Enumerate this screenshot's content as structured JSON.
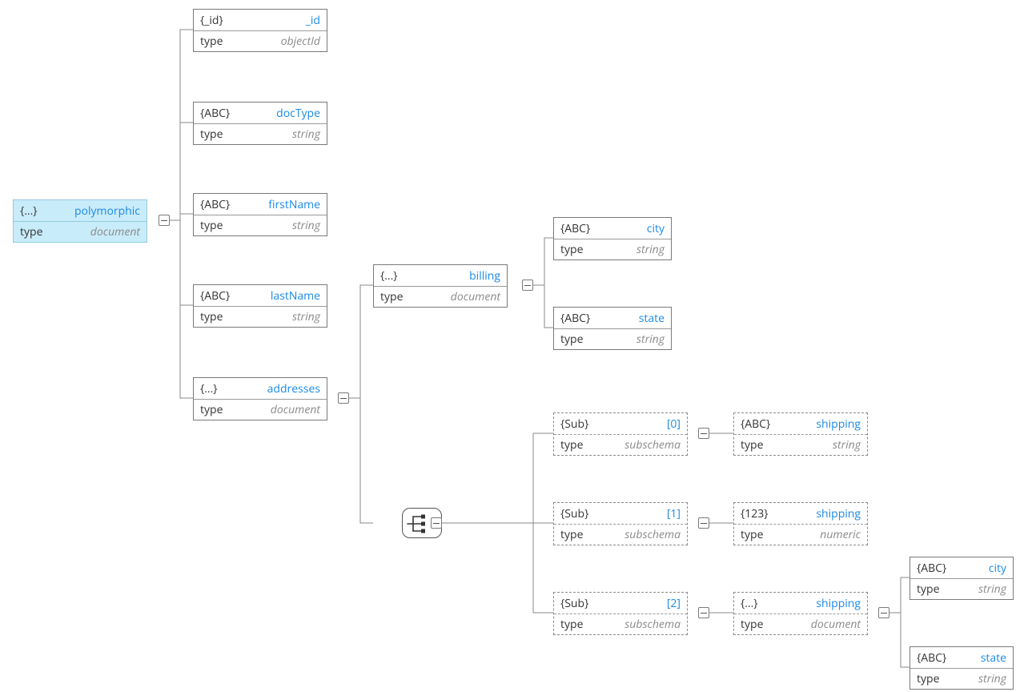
{
  "type_label": "type",
  "nodes": {
    "root": {
      "tag": "{...}",
      "name": "polymorphic",
      "type": "document"
    },
    "id": {
      "tag": "{_id}",
      "name": "_id",
      "type": "objectId"
    },
    "docType": {
      "tag": "{ABC}",
      "name": "docType",
      "type": "string"
    },
    "firstName": {
      "tag": "{ABC}",
      "name": "firstName",
      "type": "string"
    },
    "lastName": {
      "tag": "{ABC}",
      "name": "lastName",
      "type": "string"
    },
    "addresses": {
      "tag": "{...}",
      "name": "addresses",
      "type": "document"
    },
    "billing": {
      "tag": "{...}",
      "name": "billing",
      "type": "document"
    },
    "billingCity": {
      "tag": "{ABC}",
      "name": "city",
      "type": "string"
    },
    "billingState": {
      "tag": "{ABC}",
      "name": "state",
      "type": "string"
    },
    "sub0": {
      "tag": "{Sub}",
      "name": "[0]",
      "type": "subschema"
    },
    "sub1": {
      "tag": "{Sub}",
      "name": "[1]",
      "type": "subschema"
    },
    "sub2": {
      "tag": "{Sub}",
      "name": "[2]",
      "type": "subschema"
    },
    "ship0": {
      "tag": "{ABC}",
      "name": "shipping",
      "type": "string"
    },
    "ship1": {
      "tag": "{123}",
      "name": "shipping",
      "type": "numeric"
    },
    "ship2": {
      "tag": "{...}",
      "name": "shipping",
      "type": "document"
    },
    "ship2City": {
      "tag": "{ABC}",
      "name": "city",
      "type": "string"
    },
    "ship2State": {
      "tag": "{ABC}",
      "name": "state",
      "type": "string"
    }
  }
}
